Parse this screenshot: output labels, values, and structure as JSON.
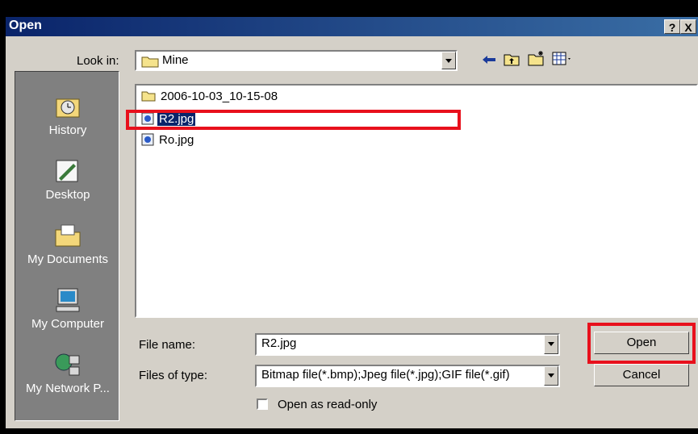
{
  "window": {
    "title": "Open",
    "help_label": "?",
    "close_label": "X"
  },
  "look_in": {
    "label": "Look in:",
    "value": "Mine"
  },
  "toolbar": {
    "back_icon": "back-arrow-icon",
    "up_icon": "up-folder-icon",
    "new_folder_icon": "new-folder-icon",
    "view_menu_icon": "view-menu-icon"
  },
  "places": [
    {
      "label": "History",
      "icon": "history-icon"
    },
    {
      "label": "Desktop",
      "icon": "desktop-icon"
    },
    {
      "label": "My Documents",
      "icon": "my-documents-icon"
    },
    {
      "label": "My Computer",
      "icon": "my-computer-icon"
    },
    {
      "label": "My Network P...",
      "icon": "my-network-places-icon"
    }
  ],
  "files": [
    {
      "name": "2006-10-03_10-15-08",
      "type": "folder",
      "selected": false
    },
    {
      "name": "R2.jpg",
      "type": "image",
      "selected": true
    },
    {
      "name": "Ro.jpg",
      "type": "image",
      "selected": false
    }
  ],
  "file_name": {
    "label": "File name:",
    "value": "R2.jpg"
  },
  "files_of_type": {
    "label": "Files of type:",
    "value": "Bitmap file(*.bmp);Jpeg file(*.jpg);GIF file(*.gif)"
  },
  "read_only": {
    "label": "Open as read-only",
    "checked": false
  },
  "buttons": {
    "open": "Open",
    "cancel": "Cancel"
  },
  "colors": {
    "titlebar": "#0a246a",
    "face": "#d4d0c8",
    "highlight": "#e8101c",
    "selection": "#0a246a"
  }
}
